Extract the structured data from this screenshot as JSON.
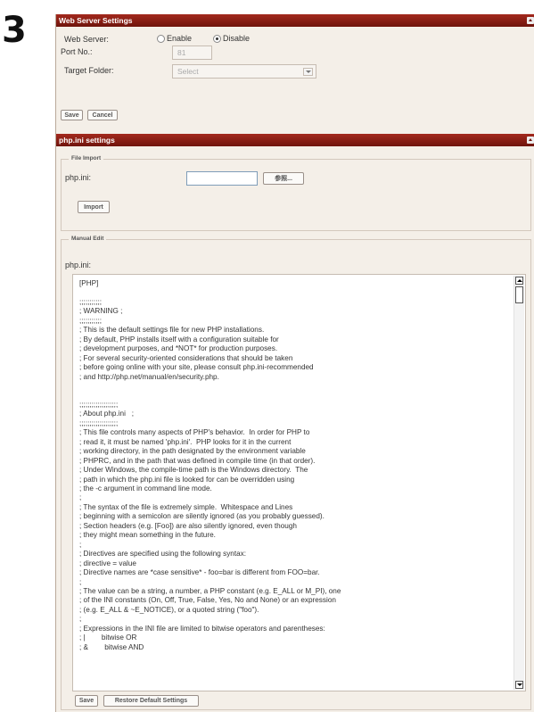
{
  "step_number": "3",
  "web_server_settings": {
    "title": "Web Server Settings",
    "web_server_label": "Web Server:",
    "enable_label": "Enable",
    "disable_label": "Disable",
    "selected": "Disable",
    "port_label": "Port No.:",
    "port_value": "81",
    "target_folder_label": "Target Folder:",
    "target_folder_value": "Select",
    "save_label": "Save",
    "cancel_label": "Cancel"
  },
  "php_ini_settings": {
    "title": "php.ini settings",
    "file_import": {
      "legend": "File Import",
      "label": "php.ini:",
      "file_value": "",
      "browse_label": "参照...",
      "import_label": "Import"
    },
    "manual_edit": {
      "legend": "Manual Edit",
      "label": "php.ini:",
      "content": "[PHP]\n\n;;;;;;;;;;;\n; WARNING ;\n;;;;;;;;;;;\n; This is the default settings file for new PHP installations.\n; By default, PHP installs itself with a configuration suitable for\n; development purposes, and *NOT* for production purposes.\n; For several security-oriented considerations that should be taken\n; before going online with your site, please consult php.ini-recommended\n; and http://php.net/manual/en/security.php.\n\n\n;;;;;;;;;;;;;;;;;;;\n; About php.ini   ;\n;;;;;;;;;;;;;;;;;;;\n; This file controls many aspects of PHP's behavior.  In order for PHP to\n; read it, it must be named 'php.ini'.  PHP looks for it in the current\n; working directory, in the path designated by the environment variable\n; PHPRC, and in the path that was defined in compile time (in that order).\n; Under Windows, the compile-time path is the Windows directory.  The\n; path in which the php.ini file is looked for can be overridden using\n; the -c argument in command line mode.\n;\n; The syntax of the file is extremely simple.  Whitespace and Lines\n; beginning with a semicolon are silently ignored (as you probably guessed).\n; Section headers (e.g. [Foo]) are also silently ignored, even though\n; they might mean something in the future.\n;\n; Directives are specified using the following syntax:\n; directive = value\n; Directive names are *case sensitive* - foo=bar is different from FOO=bar.\n;\n; The value can be a string, a number, a PHP constant (e.g. E_ALL or M_PI), one\n; of the INI constants (On, Off, True, False, Yes, No and None) or an expression\n; (e.g. E_ALL & ~E_NOTICE), or a quoted string (\"foo\").\n;\n; Expressions in the INI file are limited to bitwise operators and parentheses:\n; |        bitwise OR\n; &        bitwise AND",
      "save_label": "Save",
      "restore_label": "Restore Default Settings"
    }
  },
  "colors": {
    "header": "#8a1c12",
    "panel_background": "#f4efe8"
  }
}
